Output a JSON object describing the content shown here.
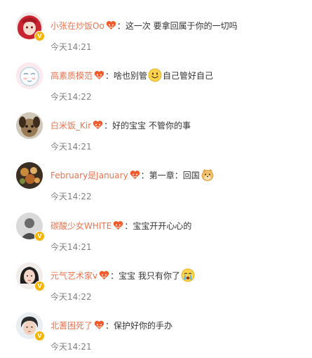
{
  "comments": [
    {
      "username": "小张在炒饭Oo",
      "separator": "：",
      "text": "这一次 要拿回属于你的一切吗",
      "text2": "",
      "emoji": "",
      "time": "今天14:21",
      "avatar": "avatar-red-hair-anime",
      "badge": "V"
    },
    {
      "username": "高素质模范",
      "separator": "：",
      "text": "啥也别管",
      "text2": "自己管好自己",
      "emoji": "smile-emoji",
      "time": "今天14:22",
      "avatar": "avatar-pastel-sketch",
      "badge": ""
    },
    {
      "username": "白米饭_Kir",
      "separator": "：",
      "text": "好的宝宝 不管你的事",
      "text2": "",
      "emoji": "",
      "time": "今天14:21",
      "avatar": "avatar-dog",
      "badge": ""
    },
    {
      "username": "February是January",
      "separator": "：",
      "text": "第一章：回国",
      "text2": "",
      "emoji": "doge-emoji",
      "time": "今天14:22",
      "avatar": "avatar-food",
      "badge": ""
    },
    {
      "username": "碳酸少女WHITE",
      "separator": "：",
      "text": "宝宝开开心心的",
      "text2": "",
      "emoji": "",
      "time": "今天14:21",
      "avatar": "avatar-person-grey",
      "badge": "V"
    },
    {
      "username": "元气艺术家v",
      "separator": "：",
      "text": "宝宝 我只有你了",
      "text2": "",
      "emoji": "crying-emoji",
      "time": "今天14:22",
      "avatar": "avatar-girl-photo",
      "badge": "V"
    },
    {
      "username": "北蓍困死了",
      "separator": "：",
      "text": "保护好你的手办",
      "text2": "",
      "emoji": "",
      "time": "今天14:21",
      "avatar": "avatar-boy-photo",
      "badge": "V"
    }
  ],
  "colors": {
    "username": "#eb7350",
    "text": "#333333",
    "time": "#808080",
    "badge": "#f5b400",
    "fan_heart": "#f25a2c"
  }
}
